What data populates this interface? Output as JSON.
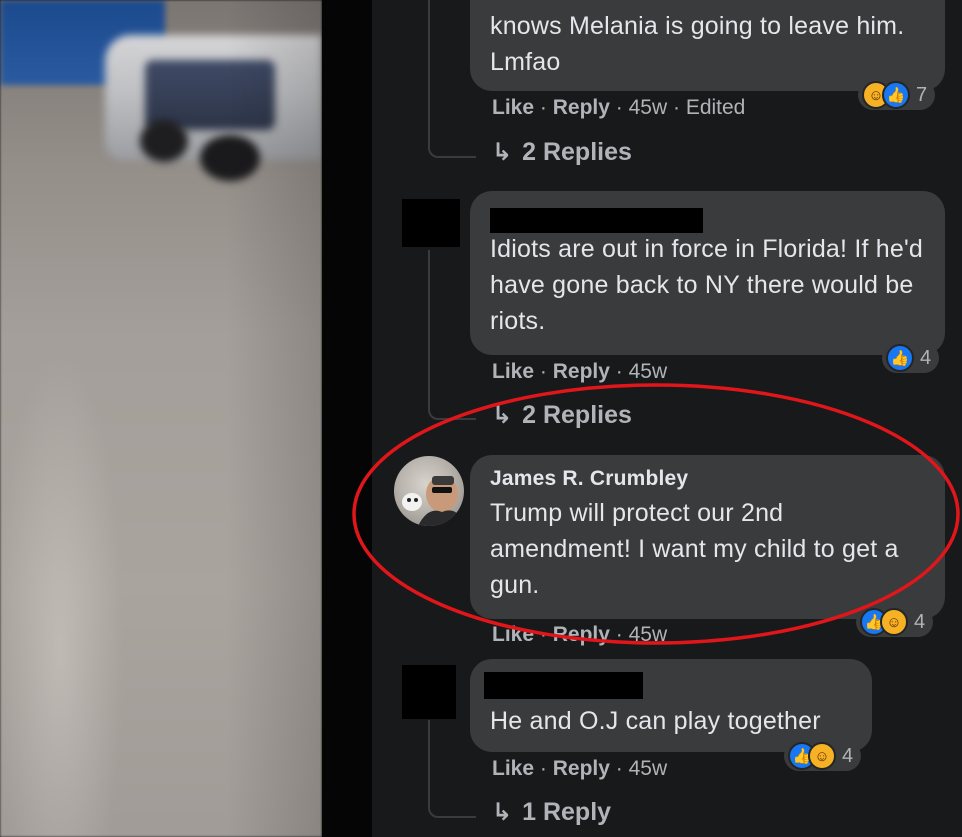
{
  "comments": [
    {
      "author": "",
      "text": "knows Melania is going to leave him. Lmfao",
      "actions": {
        "like": "Like",
        "reply": "Reply",
        "time": "45w",
        "edited": "Edited"
      },
      "reactions": {
        "icons": [
          "haha-icon",
          "like-icon"
        ],
        "count": "7"
      },
      "replies": "2 Replies"
    },
    {
      "author": "",
      "text": "Idiots are out in force in Florida! If he'd have gone back to NY there would be riots.",
      "actions": {
        "like": "Like",
        "reply": "Reply",
        "time": "45w"
      },
      "reactions": {
        "icons": [
          "like-icon"
        ],
        "count": "4"
      },
      "replies": "2 Replies"
    },
    {
      "author": "James R. Crumbley",
      "text": "Trump will protect our 2nd amendment! I want my child to get a gun.",
      "actions": {
        "like": "Like",
        "reply": "Reply",
        "time": "45w"
      },
      "reactions": {
        "icons": [
          "like-icon",
          "haha-icon"
        ],
        "count": "4"
      }
    },
    {
      "author": "",
      "text": "He and O.J can play together",
      "actions": {
        "like": "Like",
        "reply": "Reply",
        "time": "45w"
      },
      "reactions": {
        "icons": [
          "like-icon",
          "haha-icon"
        ],
        "count": "4"
      },
      "replies": "1 Reply"
    }
  ],
  "separator": "·",
  "colors": {
    "panel": "#18191a",
    "bubble": "#3a3b3c",
    "highlight_ellipse": "#e0161b",
    "like": "#1877f2",
    "haha": "#f7b125"
  }
}
